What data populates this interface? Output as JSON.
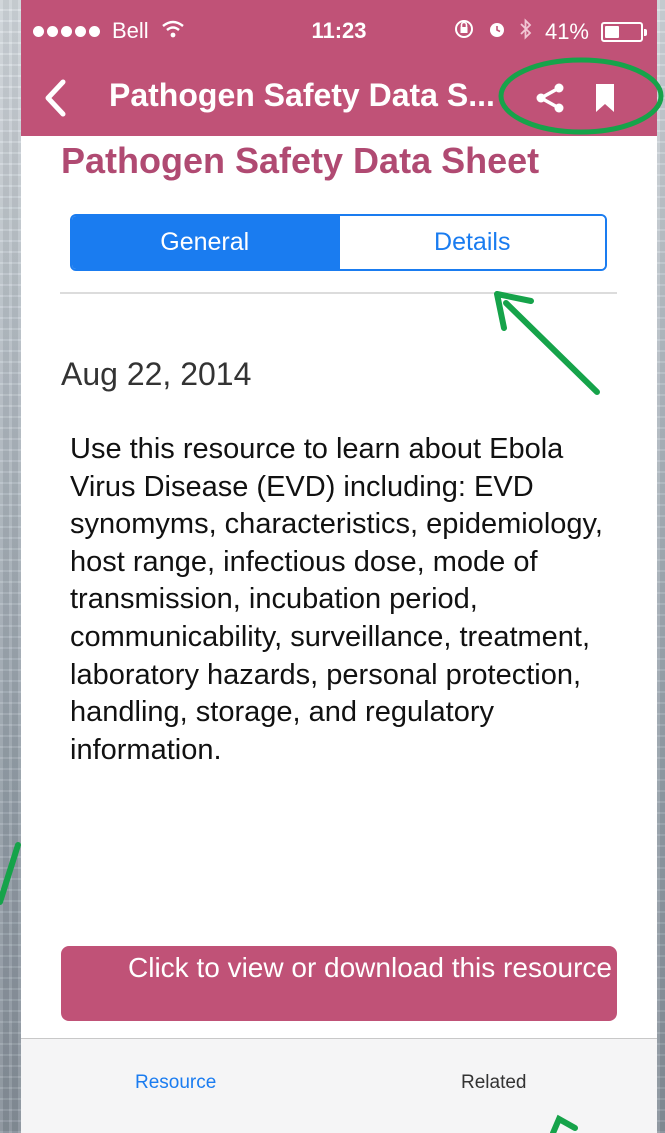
{
  "status_bar": {
    "carrier": "Bell",
    "time": "11:23",
    "battery": "41%",
    "battery_level": 0.41,
    "icons": [
      "signal-dots",
      "wifi-icon",
      "rotation-lock-icon",
      "alarm-icon",
      "bluetooth-icon",
      "battery-icon"
    ]
  },
  "nav": {
    "title": "Pathogen Safety Data S...",
    "back_icon": "chevron-left-icon",
    "share_icon": "share-icon",
    "bookmark_icon": "bookmark-icon"
  },
  "page": {
    "title": "Pathogen Safety Data Sheet",
    "tabs": [
      {
        "label": "General",
        "selected": true
      },
      {
        "label": "Details",
        "selected": false
      }
    ],
    "date": "Aug 22, 2014",
    "description": "Use this resource to learn about Ebola Virus Disease (EVD) including: EVD synomyms, characteristics, epidemiology, host range, infectious dose, mode of transmission, incubation period, communicability, surveillance, treatment, laboratory hazards, personal protection, handling, storage, and regulatory information.",
    "cta_label": "Click to view or download this resource"
  },
  "tab_bar": {
    "items": [
      {
        "label": "Resource",
        "selected": true
      },
      {
        "label": "Related",
        "selected": false
      }
    ]
  },
  "colors": {
    "brand_pink": "#c05277",
    "title_pink": "#b04a72",
    "ios_blue": "#1a7cf0",
    "annotation_green": "#16a34a"
  }
}
